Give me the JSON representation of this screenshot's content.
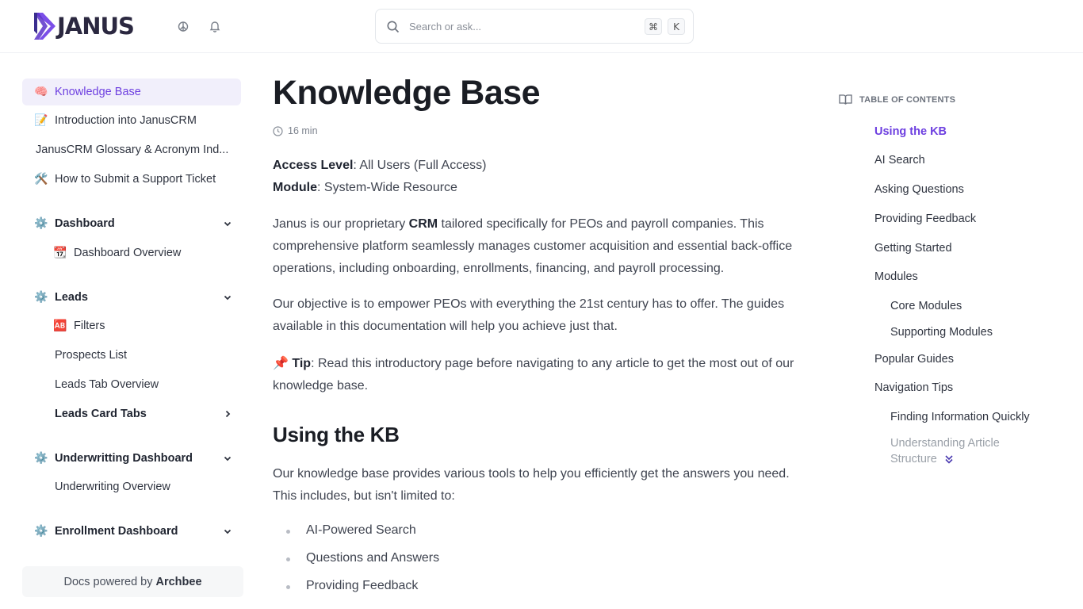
{
  "brand": {
    "name": "JANUS",
    "accent": "#6d3fe0"
  },
  "header": {
    "icons": [
      "theme-toggle-icon",
      "bell-icon"
    ],
    "search": {
      "placeholder": "Search or ask...",
      "shortcut_mod": "⌘",
      "shortcut_key": "K"
    }
  },
  "sidebar": {
    "items": [
      {
        "emoji": "🧠",
        "label": "Knowledge Base",
        "active": true
      },
      {
        "emoji": "📝",
        "label": "Introduction into JanusCRM"
      },
      {
        "label": "JanusCRM Glossary & Acronym Ind..."
      },
      {
        "emoji": "🛠️",
        "label": "How to Submit a Support Ticket"
      },
      {
        "emoji": "⚙️",
        "label": "Dashboard",
        "expanded": true
      },
      {
        "emoji": "📆",
        "label": "Dashboard Overview"
      },
      {
        "emoji": "⚙️",
        "label": "Leads",
        "expanded": true
      },
      {
        "emoji": "🆎",
        "label": "Filters"
      },
      {
        "label": "Prospects List"
      },
      {
        "label": "Leads Tab Overview"
      },
      {
        "label": "Leads Card Tabs",
        "expanded": false
      },
      {
        "emoji": "⚙️",
        "label": "Underwritting Dashboard",
        "expanded": true
      },
      {
        "label": "Underwriting Overview"
      },
      {
        "emoji": "⚙️",
        "label": "Enrollment Dashboard",
        "expanded": true
      }
    ],
    "powered": {
      "prefix": "Docs powered by",
      "name": "Archbee"
    }
  },
  "article": {
    "title": "Knowledge Base",
    "read_time": "16 min",
    "access_label": "Access Level",
    "access_value": ": All Users (Full Access)",
    "module_label": "Module",
    "module_value": ": System-Wide Resource",
    "intro_pre": "Janus is our proprietary ",
    "intro_bold": "CRM",
    "intro_post": " tailored specifically for PEOs and payroll companies. This comprehensive platform seamlessly manages customer acquisition and essential back-office operations, including onboarding, enrollments, financing, and payroll processing.",
    "objective": "Our objective is to empower PEOs with everything the 21st century has to offer. The guides available in this documentation will help you achieve just that.",
    "tip_emoji": "📌",
    "tip_label": "Tip",
    "tip_text": ": Read this introductory page before navigating to any article to get the most out of our knowledge base.",
    "section_title": "Using the KB",
    "section_text": "Our knowledge base provides various tools to help you efficiently get the answers you need. This includes, but isn't limited to:",
    "bullets": [
      "AI-Powered Search",
      "Questions and Answers",
      "Providing Feedback"
    ]
  },
  "toc": {
    "heading": "TABLE OF CONTENTS",
    "items": [
      {
        "label": "Using the KB",
        "active": true
      },
      {
        "label": "AI Search"
      },
      {
        "label": "Asking Questions"
      },
      {
        "label": "Providing Feedback"
      },
      {
        "label": "Getting Started"
      },
      {
        "label": "Modules"
      },
      {
        "label": "Core Modules",
        "sub": true
      },
      {
        "label": "Supporting Modules",
        "sub": true
      },
      {
        "label": "Popular Guides"
      },
      {
        "label": "Navigation Tips"
      },
      {
        "label": "Finding Information Quickly",
        "sub": true
      },
      {
        "label": "Understanding Article Structure",
        "sub": true,
        "faded": true
      }
    ]
  }
}
